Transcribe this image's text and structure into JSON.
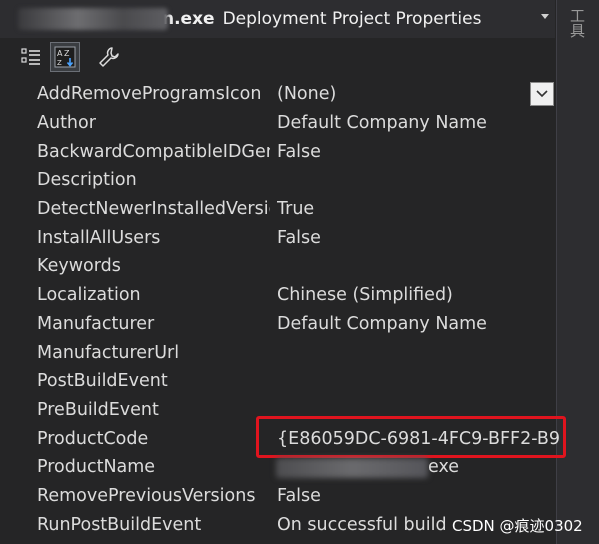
{
  "titlebar": {
    "name_suffix": "n.exe",
    "title": "Deployment Project Properties"
  },
  "side_panel": {
    "label": "工具"
  },
  "toolbar": {
    "buttons": [
      {
        "icon": "categorized-icon"
      },
      {
        "icon": "alphabetical-icon"
      },
      {
        "icon": "wrench-icon"
      }
    ]
  },
  "properties": [
    {
      "name": "AddRemoveProgramsIcon",
      "value": "(None)"
    },
    {
      "name": "Author",
      "value": "Default Company Name"
    },
    {
      "name": "BackwardCompatibleIDGeneration",
      "value": "False"
    },
    {
      "name": "Description",
      "value": ""
    },
    {
      "name": "DetectNewerInstalledVersion",
      "value": "True"
    },
    {
      "name": "InstallAllUsers",
      "value": "False"
    },
    {
      "name": "Keywords",
      "value": ""
    },
    {
      "name": "Localization",
      "value": "Chinese (Simplified)"
    },
    {
      "name": "Manufacturer",
      "value": "Default Company Name"
    },
    {
      "name": "ManufacturerUrl",
      "value": ""
    },
    {
      "name": "PostBuildEvent",
      "value": ""
    },
    {
      "name": "PreBuildEvent",
      "value": ""
    },
    {
      "name": "ProductCode",
      "value": "{E86059DC-6981-4FC9-BFF2-B9"
    },
    {
      "name": "ProductName",
      "value": ""
    },
    {
      "name": "RemovePreviousVersions",
      "value": "False"
    },
    {
      "name": "RunPostBuildEvent",
      "value": "On successful build"
    }
  ],
  "product_name_suffix": "exe",
  "watermark": "CSDN @痕迹0302",
  "colors": {
    "background": "#252526",
    "highlight_border": "#e0141e",
    "text": "#dcdcdc"
  }
}
